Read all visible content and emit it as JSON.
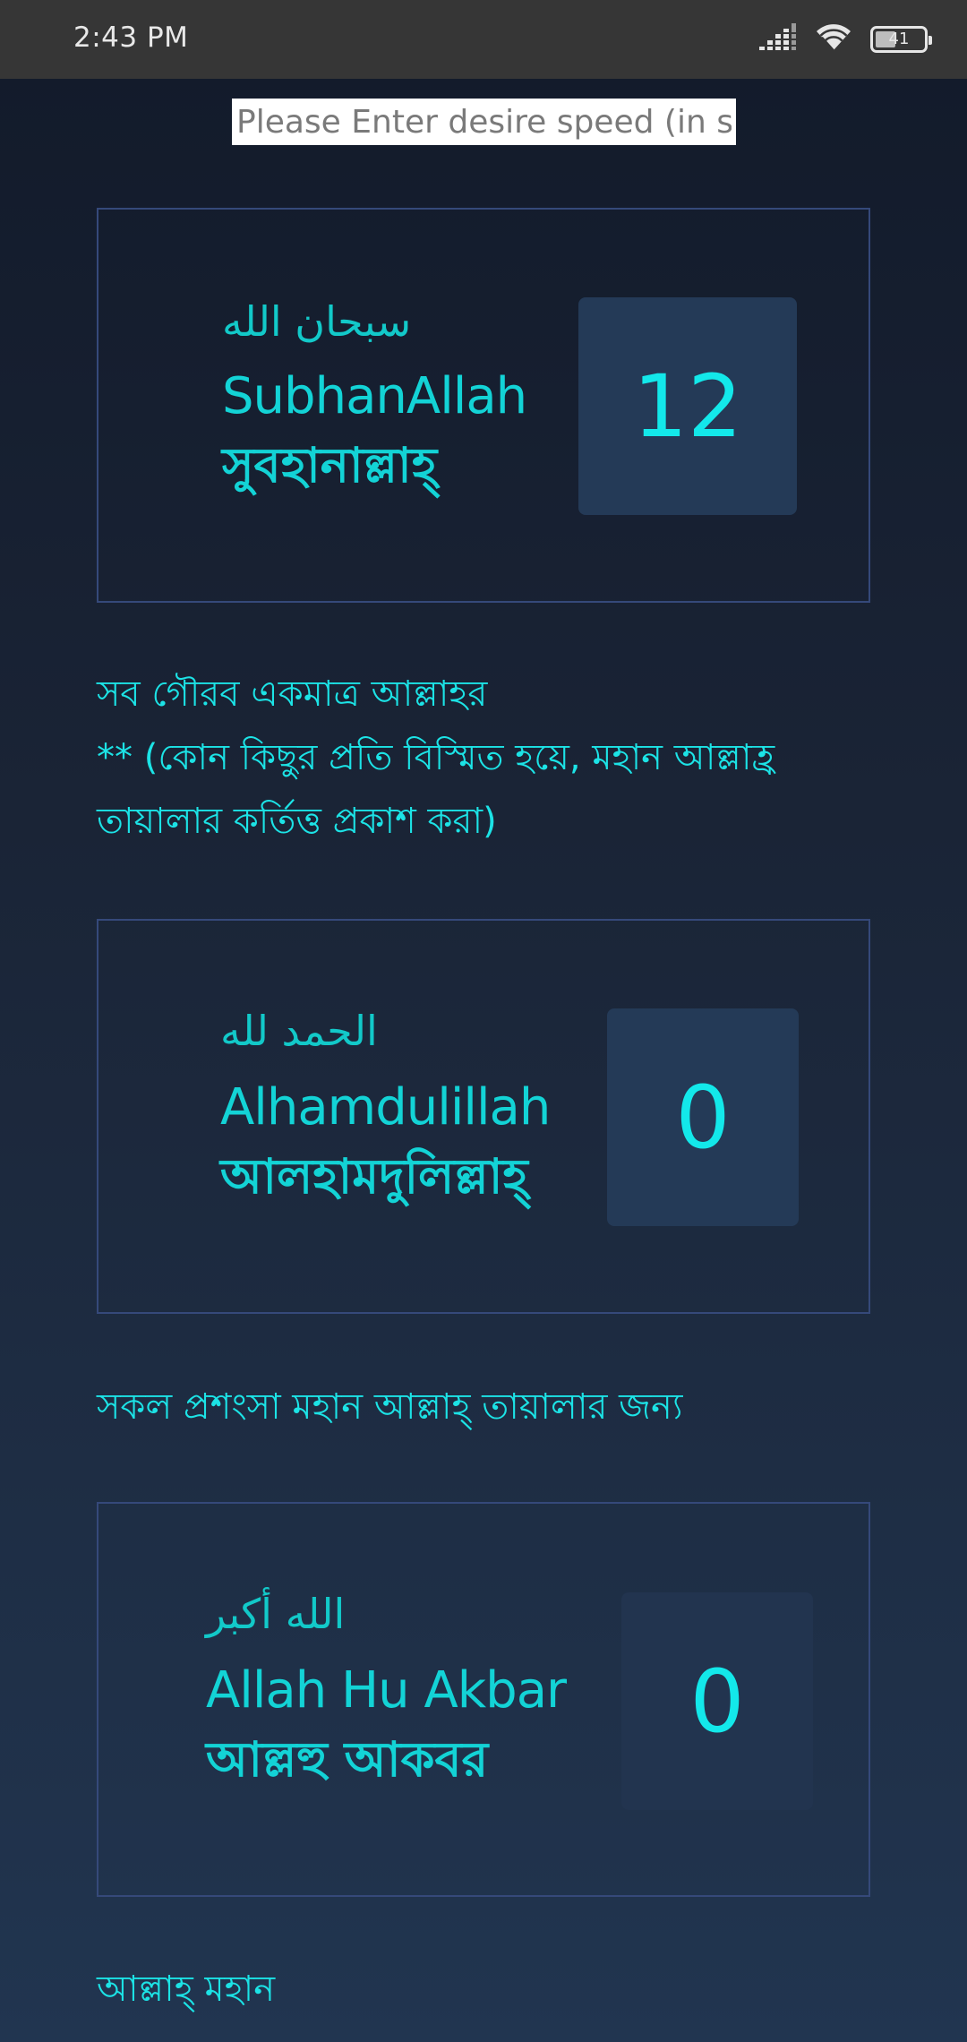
{
  "status_bar": {
    "time": "2:43 PM",
    "battery_level": "41"
  },
  "speed_input": {
    "placeholder": "Please Enter desire speed (in seconds)",
    "value": ""
  },
  "cards": [
    {
      "arabic": "سبحان الله",
      "latin": "SubhanAllah",
      "bengali": "সুবহানাল্লাহ্",
      "count": "12"
    },
    {
      "arabic": "الحمد لله",
      "latin": "Alhamdulillah",
      "bengali": "আলহামদুলিল্লাহ্",
      "count": "0"
    },
    {
      "arabic": "الله أكبر",
      "latin": "Allah Hu Akbar",
      "bengali": "আল্লহু আকবর",
      "count": "0"
    }
  ],
  "meanings": [
    {
      "line1": "সব গৌরব একমাত্র আল্লাহর",
      "line2": "** (কোন কিছুর প্রতি বিস্মিত হয়ে, মহান আল্লাহ্র",
      "line3": "তায়ালার কর্তিত্ত প্রকাশ করা)"
    },
    {
      "line1": "সকল প্রশংসা মহান আল্লাহ্ তায়ালার জন্য"
    },
    {
      "line1": "আল্লাহ্ মহান"
    }
  ],
  "colors": {
    "accent": "#13e8ea",
    "card_border": "#35497a",
    "count_box": "#243a57",
    "status_bar": "#363636"
  },
  "icons": [
    "signal-icon",
    "wifi-icon",
    "battery-icon"
  ]
}
